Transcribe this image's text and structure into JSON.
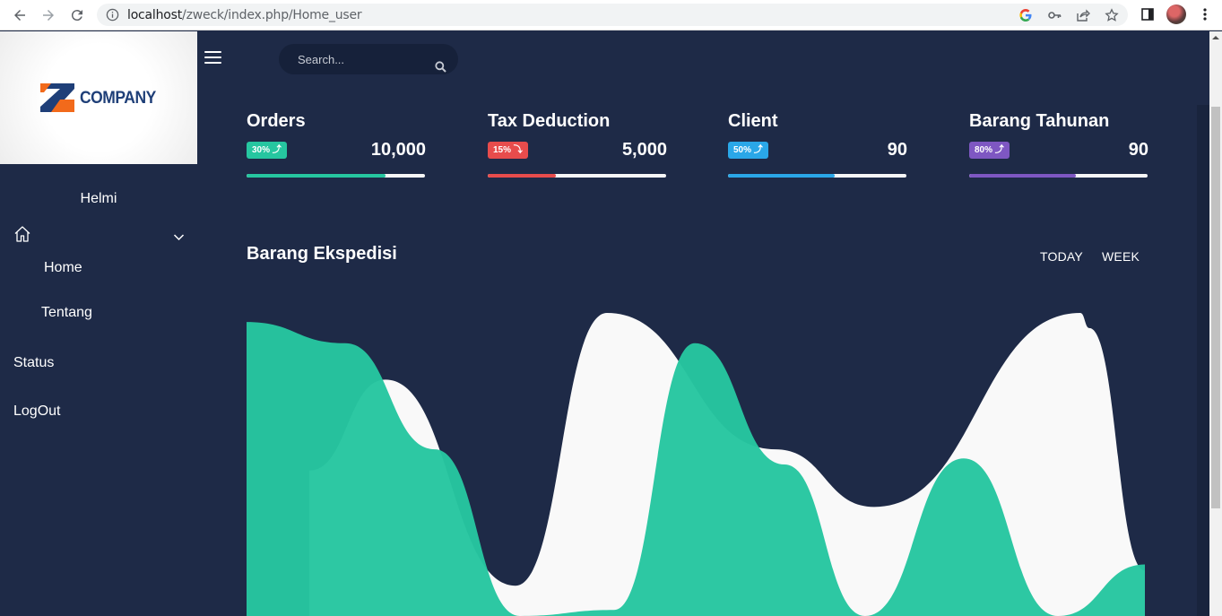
{
  "browser": {
    "url_host": "localhost",
    "url_path": "/zweck/index.php/Home_user"
  },
  "sidebar": {
    "logo_text": "COMPANY",
    "username": "Helmi",
    "items": [
      {
        "label": "Home",
        "icon": "home-icon",
        "expandable": true
      },
      {
        "label": "Tentang"
      },
      {
        "label": "Status"
      },
      {
        "label": "LogOut"
      }
    ]
  },
  "topbar": {
    "search_placeholder": "Search..."
  },
  "stats": [
    {
      "title": "Orders",
      "badge": "30% ⤴",
      "value": "10,000",
      "progress": 0.78,
      "color": "#26c6a0"
    },
    {
      "title": "Tax Deduction",
      "badge": "15% ⤵",
      "value": "5,000",
      "progress": 0.38,
      "color": "#e74c4c"
    },
    {
      "title": "Client",
      "badge": "50% ⤴",
      "value": "90",
      "progress": 0.6,
      "color": "#2aa7e8"
    },
    {
      "title": "Barang Tahunan",
      "badge": "80% ⤴",
      "value": "90",
      "progress": 0.6,
      "color": "#7e57c2"
    }
  ],
  "chart_section": {
    "title": "Barang Ekspedisi",
    "buttons": [
      "TODAY",
      "WEEK"
    ]
  },
  "colors": {
    "background": "#1e2a47",
    "accent_green": "#26c6a0",
    "series_white": "#f9f9f9"
  },
  "chart_data": {
    "type": "area",
    "title": "Barang Ekspedisi",
    "xlabel": "",
    "ylabel": "",
    "series": [
      {
        "values": [
          0.48,
          0.78,
          0.1,
          1.0,
          0.55,
          0.36,
          1.0,
          0.95,
          0.15,
          0.02
        ]
      },
      {
        "values": [
          0.97,
          0.9,
          0.55,
          0.0,
          0.02,
          0.9,
          0.5,
          0.0,
          0.52,
          0.0,
          0.17
        ]
      }
    ]
  }
}
